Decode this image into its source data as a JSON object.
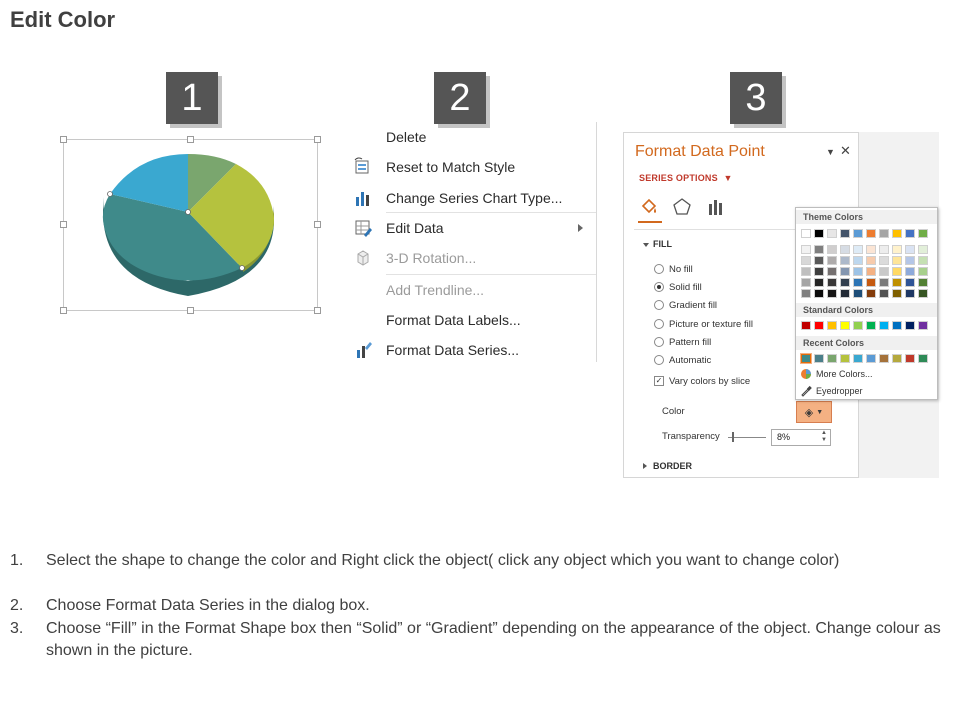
{
  "title": "Edit Color",
  "steps": [
    "1",
    "2",
    "3"
  ],
  "pie": {
    "colors": [
      "#7aa66e",
      "#b5c23e",
      "#3f8a8a",
      "#3aa8d0"
    ]
  },
  "context_menu": {
    "items": [
      {
        "label": "Delete",
        "icon": "none",
        "disabled": false
      },
      {
        "label": "Reset to Match Style",
        "icon": "reset-style-icon",
        "disabled": false
      },
      {
        "label": "Change Series Chart Type...",
        "icon": "bar-chart-icon",
        "disabled": false
      },
      {
        "label": "Edit Data",
        "icon": "edit-data-icon",
        "disabled": false,
        "submenu": true
      },
      {
        "label": "3-D Rotation...",
        "icon": "cube-icon",
        "disabled": true
      },
      {
        "label": "Add Trendline...",
        "icon": "none",
        "disabled": true
      },
      {
        "label": "Format Data Labels...",
        "icon": "none",
        "disabled": false
      },
      {
        "label": "Format Data Series...",
        "icon": "format-series-icon",
        "disabled": false
      }
    ]
  },
  "format_pane": {
    "title": "Format Data Point",
    "series_options": "SERIES OPTIONS",
    "fill_header": "FILL",
    "fill_options": [
      "No fill",
      "Solid fill",
      "Gradient fill",
      "Picture or texture fill",
      "Pattern fill",
      "Automatic"
    ],
    "selected_fill": "Solid fill",
    "vary_colors": "Vary colors by slice",
    "color_label": "Color",
    "transparency_label": "Transparency",
    "transparency_value": "8%",
    "border_header": "BORDER",
    "accent_color": "#d2691e"
  },
  "color_picker": {
    "theme_header": "Theme Colors",
    "standard_header": "Standard Colors",
    "recent_header": "Recent Colors",
    "more_colors": "More Colors...",
    "eyedropper": "Eyedropper",
    "theme_top": [
      "#ffffff",
      "#000000",
      "#e7e6e6",
      "#44546a",
      "#5b9bd5",
      "#ed7d31",
      "#a5a5a5",
      "#ffc000",
      "#4472c4",
      "#70ad47"
    ],
    "theme_shades": [
      [
        "#f2f2f2",
        "#7f7f7f",
        "#d0cece",
        "#d6dce4",
        "#deebf6",
        "#fbe5d5",
        "#ededed",
        "#fff2cc",
        "#dae3f3",
        "#e2efd9"
      ],
      [
        "#d8d8d8",
        "#595959",
        "#aeabab",
        "#adb9ca",
        "#bdd7ee",
        "#f7cbac",
        "#dbdbdb",
        "#fee599",
        "#b4c6e7",
        "#c5e0b3"
      ],
      [
        "#bfbfbf",
        "#3f3f3f",
        "#757070",
        "#8496b0",
        "#9dc3e6",
        "#f4b183",
        "#c9c9c9",
        "#ffd965",
        "#8eaadb",
        "#a8d08d"
      ],
      [
        "#a5a5a5",
        "#262626",
        "#3a3838",
        "#323f4f",
        "#2e75b5",
        "#c55a11",
        "#7b7b7b",
        "#bf9000",
        "#2f5496",
        "#538135"
      ],
      [
        "#7f7f7f",
        "#0c0c0c",
        "#171616",
        "#222a35",
        "#1e4e79",
        "#833c0b",
        "#525252",
        "#7f6000",
        "#1f3864",
        "#375623"
      ]
    ],
    "standard": [
      "#c00000",
      "#ff0000",
      "#ffc000",
      "#ffff00",
      "#92d050",
      "#00b050",
      "#00b0f0",
      "#0070c0",
      "#002060",
      "#7030a0"
    ],
    "recent": [
      "#3f8a8a",
      "#4b7f8a",
      "#7aa66e",
      "#b5c23e",
      "#3aa8d0",
      "#5b9bd5",
      "#a5723a",
      "#b5a93e",
      "#c0392b",
      "#2e8b57"
    ]
  },
  "instructions": [
    {
      "num": "1.",
      "text": "Select the shape to change the color and Right click the object( click any object which you want to change color)"
    },
    {
      "num": "2.",
      "text": "Choose Format Data Series in the dialog box."
    },
    {
      "num": "3.",
      "text": "Choose “Fill” in the Format Shape box then “Solid” or “Gradient” depending on the appearance of the object. Change colour as shown in the picture."
    }
  ]
}
